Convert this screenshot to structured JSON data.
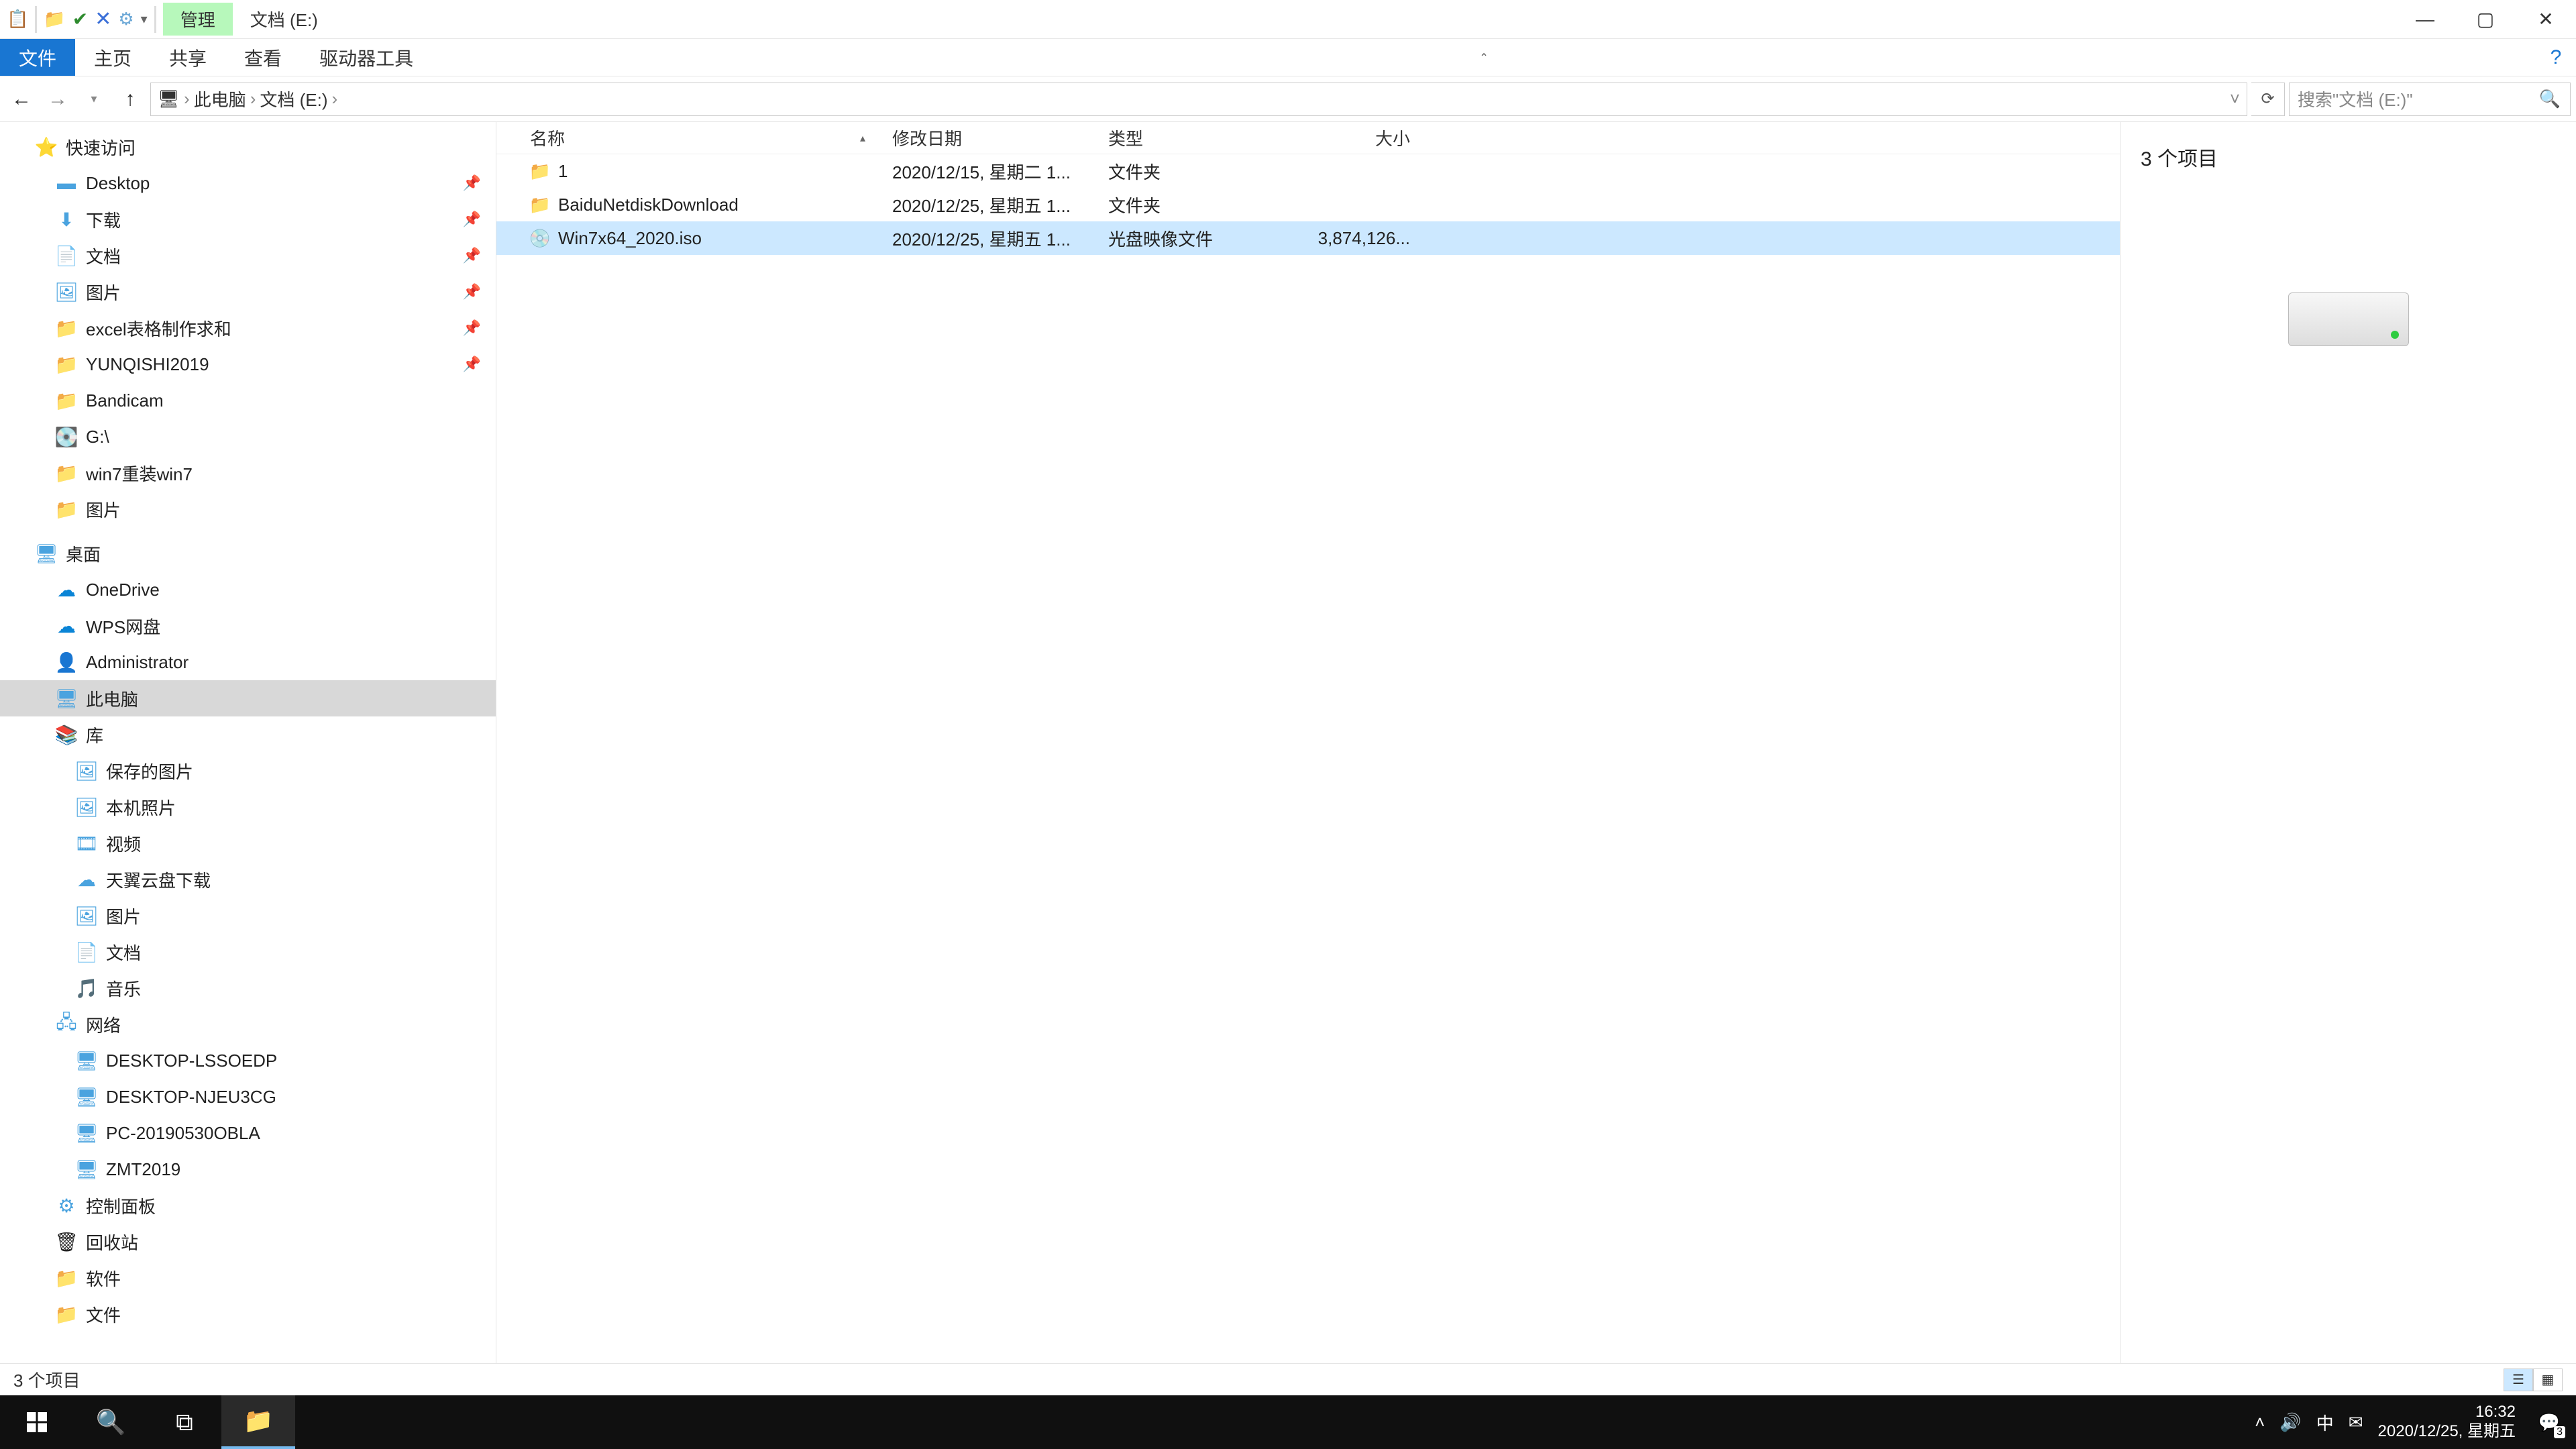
{
  "title_tab_manage": "管理",
  "title_tab_path": "文档 (E:)",
  "ribbon": {
    "file": "文件",
    "home": "主页",
    "share": "共享",
    "view": "查看",
    "drivetools": "驱动器工具"
  },
  "breadcrumb": {
    "thispc": "此电脑",
    "drive": "文档 (E:)"
  },
  "search_placeholder": "搜索\"文档 (E:)\"",
  "tree": {
    "quick_access": "快速访问",
    "desktop": "Desktop",
    "downloads": "下载",
    "documents": "文档",
    "pictures": "图片",
    "excel": "excel表格制作求和",
    "yunqishi": "YUNQISHI2019",
    "bandicam": "Bandicam",
    "gdrive": "G:\\",
    "win7": "win7重装win7",
    "pictures2": "图片",
    "desktop_cn": "桌面",
    "onedrive": "OneDrive",
    "wps": "WPS网盘",
    "admin": "Administrator",
    "thispc": "此电脑",
    "library": "库",
    "saved_pics": "保存的图片",
    "local_photos": "本机照片",
    "videos": "视频",
    "tianyi": "天翼云盘下载",
    "pics3": "图片",
    "docs2": "文档",
    "music": "音乐",
    "network": "网络",
    "desk_lssoedp": "DESKTOP-LSSOEDP",
    "desk_njeu": "DESKTOP-NJEU3CG",
    "pc2019": "PC-20190530OBLA",
    "zmt": "ZMT2019",
    "control": "控制面板",
    "recycle": "回收站",
    "software": "软件",
    "file": "文件"
  },
  "columns": {
    "name": "名称",
    "date": "修改日期",
    "type": "类型",
    "size": "大小"
  },
  "files": [
    {
      "name": "1",
      "date": "2020/12/15, 星期二 1...",
      "type": "文件夹",
      "size": "",
      "icon": "folder"
    },
    {
      "name": "BaiduNetdiskDownload",
      "date": "2020/12/25, 星期五 1...",
      "type": "文件夹",
      "size": "",
      "icon": "folder"
    },
    {
      "name": "Win7x64_2020.iso",
      "date": "2020/12/25, 星期五 1...",
      "type": "光盘映像文件",
      "size": "3,874,126...",
      "icon": "iso",
      "selected": true
    }
  ],
  "preview_count": "3 个项目",
  "status_count": "3 个项目",
  "clock_time": "16:32",
  "clock_date": "2020/12/25, 星期五",
  "notif_badge": "3"
}
